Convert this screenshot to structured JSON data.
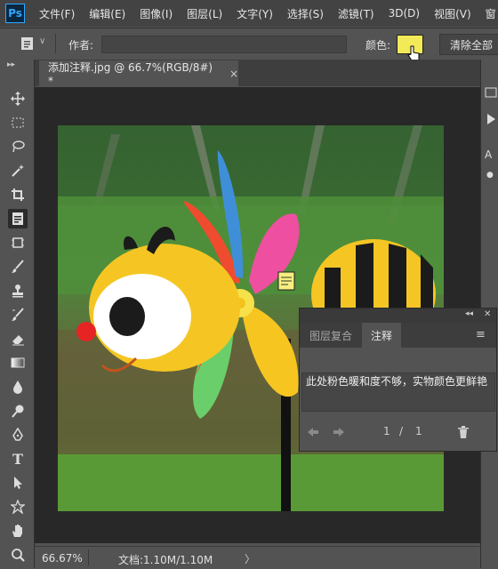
{
  "app": {
    "logo": "Ps"
  },
  "menu": [
    "文件(F)",
    "编辑(E)",
    "图像(I)",
    "图层(L)",
    "文字(Y)",
    "选择(S)",
    "滤镜(T)",
    "3D(D)",
    "视图(V)",
    "窗"
  ],
  "options": {
    "author_label": "作者:",
    "author_value": "",
    "color_label": "颜色:",
    "note_color": "#f2ea58",
    "clear_label": "清除全部"
  },
  "tools": [
    "move-icon",
    "marquee-icon",
    "lasso-icon",
    "magic-wand-icon",
    "crop-icon",
    "note-icon",
    "frame-icon",
    "brush-icon",
    "stamp-icon",
    "history-brush-icon",
    "eraser-icon",
    "gradient-icon",
    "blur-icon",
    "dodge-icon",
    "pen-icon",
    "type-icon",
    "path-select-icon",
    "shape-icon",
    "hand-icon",
    "zoom-icon"
  ],
  "document": {
    "tab_title": "添加注释.jpg @ 66.7%(RGB/8#) *",
    "close_glyph": "×"
  },
  "status": {
    "zoom": "66.67%",
    "doc_info": "文档:1.10M/1.10M",
    "arrow": "〉"
  },
  "notes_panel": {
    "collapse_glyph": "◂◂",
    "close_glyph": "✕",
    "tab_layer_comps": "图层复合",
    "tab_notes": "注释",
    "menu_glyph": "≡",
    "note_text": "此处粉色暖和度不够，实物颜色更鲜艳",
    "page_current": "1",
    "page_sep": "/",
    "page_total": "1"
  },
  "right_dock": {
    "label": "A"
  }
}
